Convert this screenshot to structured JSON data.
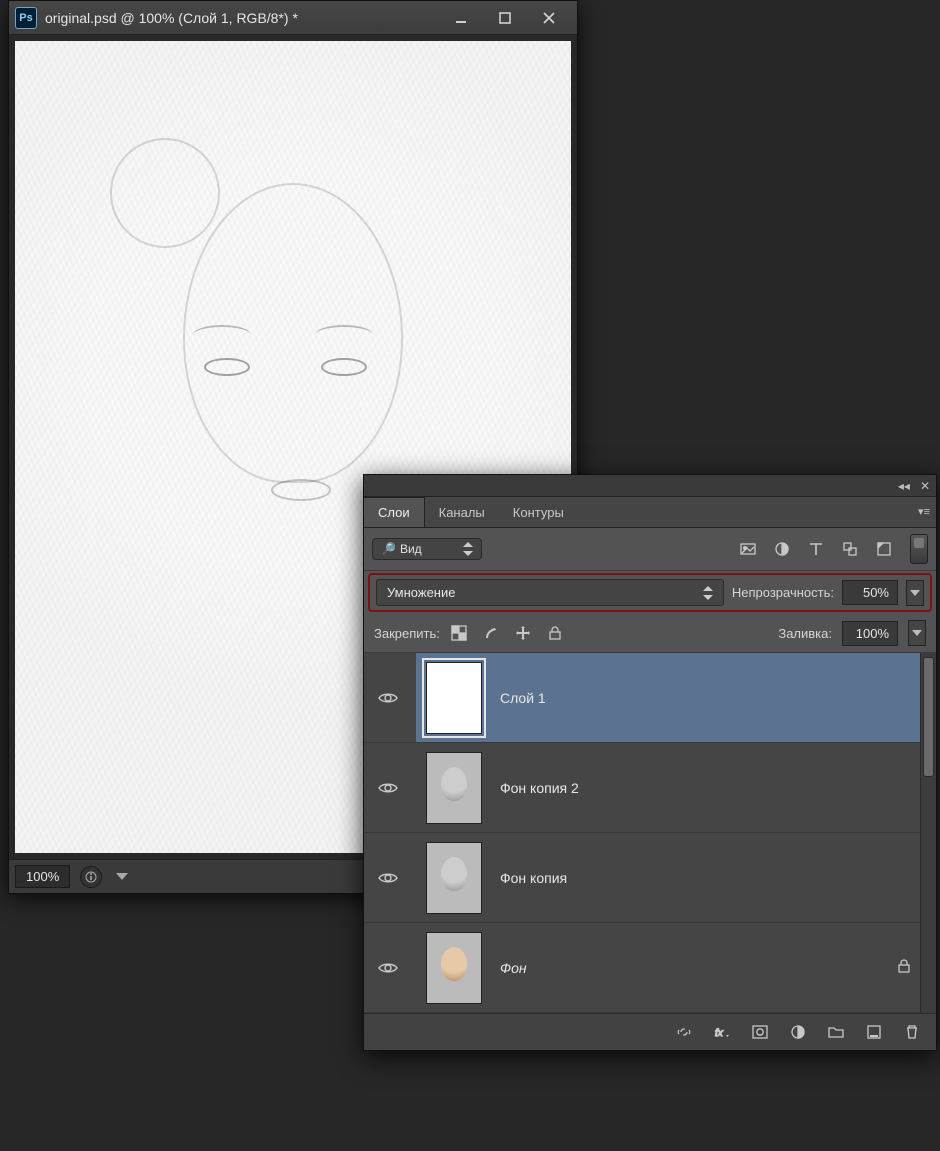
{
  "document": {
    "app_icon": "Ps",
    "title": "original.psd @ 100% (Слой 1, RGB/8*) *",
    "zoom": "100%"
  },
  "panel": {
    "tabs": {
      "layers": "Слои",
      "channels": "Каналы",
      "paths": "Контуры"
    },
    "filter_type": "Вид",
    "blend_mode": "Умножение",
    "opacity_label": "Непрозрачность:",
    "opacity_value": "50%",
    "lock_label": "Закрепить:",
    "fill_label": "Заливка:",
    "fill_value": "100%",
    "layers": [
      {
        "name": "Слой 1",
        "italic": false,
        "selected": true,
        "thumb": "sketch",
        "locked": false
      },
      {
        "name": "Фон копия 2",
        "italic": false,
        "selected": false,
        "thumb": "blur",
        "locked": false
      },
      {
        "name": "Фон копия",
        "italic": false,
        "selected": false,
        "thumb": "bw",
        "locked": false
      },
      {
        "name": "Фон",
        "italic": true,
        "selected": false,
        "thumb": "color",
        "locked": true
      }
    ]
  }
}
